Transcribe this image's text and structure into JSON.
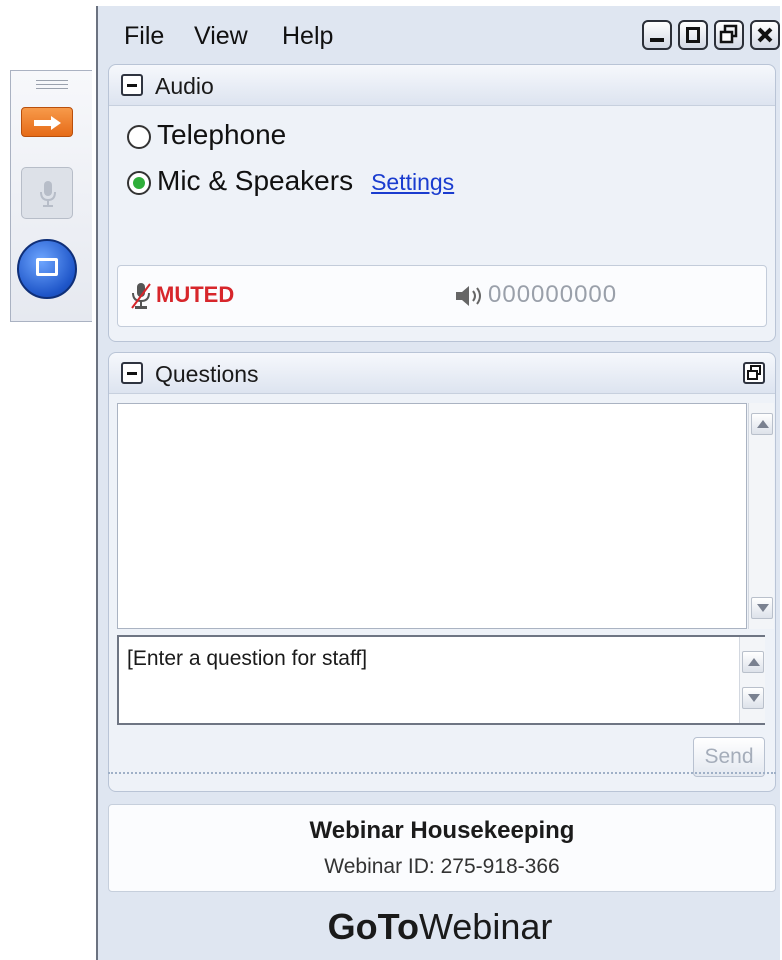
{
  "menu": {
    "items": [
      "File",
      "View",
      "Help"
    ]
  },
  "window_controls": [
    "minimize-icon",
    "maximize-icon",
    "restore-icon",
    "close-icon"
  ],
  "audio": {
    "title": "Audio",
    "options": [
      {
        "label": "Telephone",
        "selected": false
      },
      {
        "label": "Mic & Speakers",
        "selected": true
      }
    ],
    "settings_link": "Settings",
    "mic_status": "MUTED",
    "speaker_meter": "000000000"
  },
  "questions": {
    "title": "Questions",
    "input_placeholder": "[Enter a question for staff]",
    "send_label": "Send"
  },
  "webinar": {
    "title": "Webinar Housekeeping",
    "id_text": "Webinar ID: 275-918-366"
  },
  "brand": {
    "bold": "GoTo",
    "normal": "Webinar"
  },
  "colors": {
    "muted": "#d7262b",
    "link": "#1a3ccf",
    "arrow_button": "#e66b18",
    "screen_button": "#1e55c8"
  }
}
